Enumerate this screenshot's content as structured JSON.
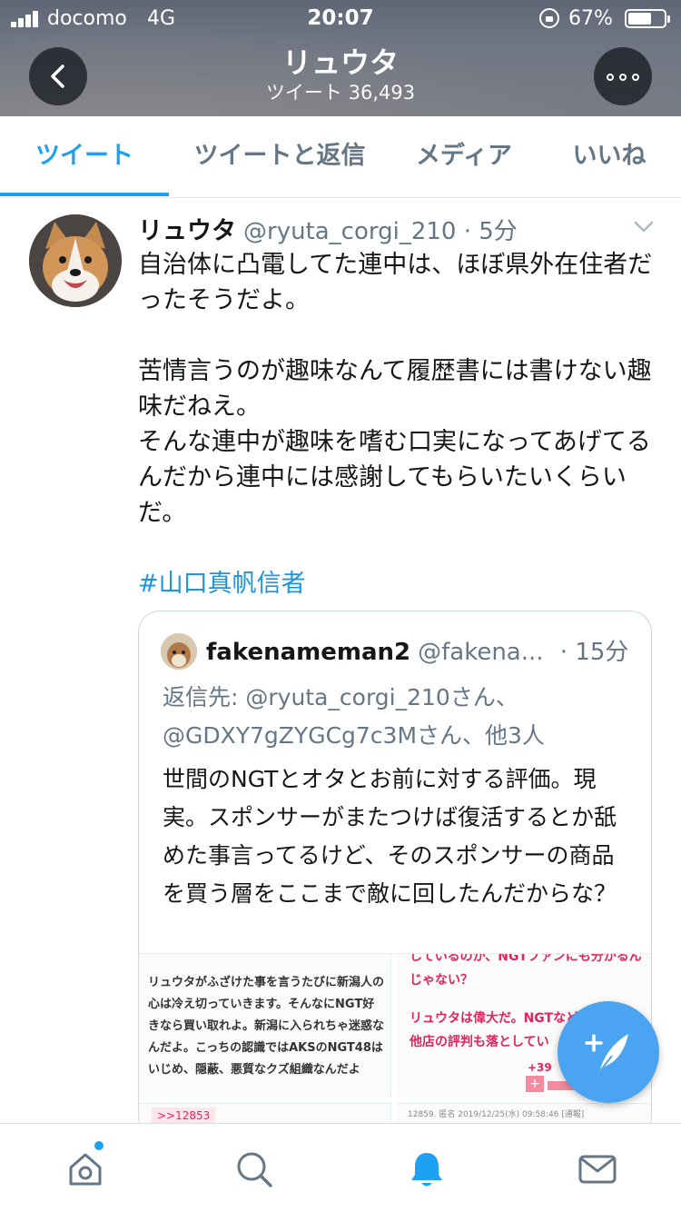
{
  "status_bar": {
    "carrier": "docomo",
    "network": "4G",
    "time": "20:07",
    "battery_percent": "67%",
    "battery_level": 0.67
  },
  "header": {
    "name": "リュウタ",
    "tweet_count": "ツイート 36,493"
  },
  "tabs": [
    {
      "label": "ツイート",
      "active": true
    },
    {
      "label": "ツイートと返信",
      "active": false
    },
    {
      "label": "メディア",
      "active": false
    },
    {
      "label": "いいね",
      "active": false
    }
  ],
  "tweet": {
    "author": "リュウタ",
    "handle_time": "@ryuta_corgi_210 · 5分",
    "paragraphs": [
      "自治体に凸電してた連中は、ほぼ県外在住者だったそうだよ。",
      "苦情言うのが趣味なんて履歴書には書けない趣味だねえ。\nそんな連中が趣味を嗜む口実になってあげてるんだから連中には感謝してもらいたいくらいだ。"
    ],
    "hashtag": "#山口真帆信者"
  },
  "quoted_tweet": {
    "name": "fakenameman2",
    "handle": "@fakena...",
    "time": "· 15分",
    "reply_to": "返信先: @ryuta_corgi_210さん、@GDXY7gZYGCg7c3Mさん、他3人",
    "text": "世間のNGTとオタとお前に対する評価。現実。スポンサーがまたつけば復活するとか舐めた事言ってるけど、そのスポンサーの商品を買う層をここまで敵に回したんだからな？",
    "image_left_text": "リュウタがふざけた事を言うたびに新潟人の心は冷え切っていきます。そんなにNGT好きなら買い取れよ。新潟に入られちゃ迷惑なんだよ。こっちの認識ではAKSのNGT48はいじめ、隠蔽、悪質なクズ組織なんだよ",
    "image_right_top": "しているのか、NGTファンにも分かるんじゃない？",
    "image_right_mid": "リュウタは偉大だ。NGTなど他店の評判も落としてい",
    "image_right_count": "+39",
    "image_bottom_left": ">>12853",
    "image_bottom_right": "12859. 匿名 2019/12/25(水) 09:58:46 [通報]"
  },
  "colors": {
    "accent": "#1da1f2",
    "secondary_text": "#657786",
    "fab": "#4ba4f2"
  },
  "icons": [
    "back-arrow-icon",
    "more-options-icon",
    "chevron-down-icon",
    "compose-tweet-icon",
    "home-icon",
    "search-icon",
    "notifications-bell-icon",
    "messages-envelope-icon"
  ]
}
